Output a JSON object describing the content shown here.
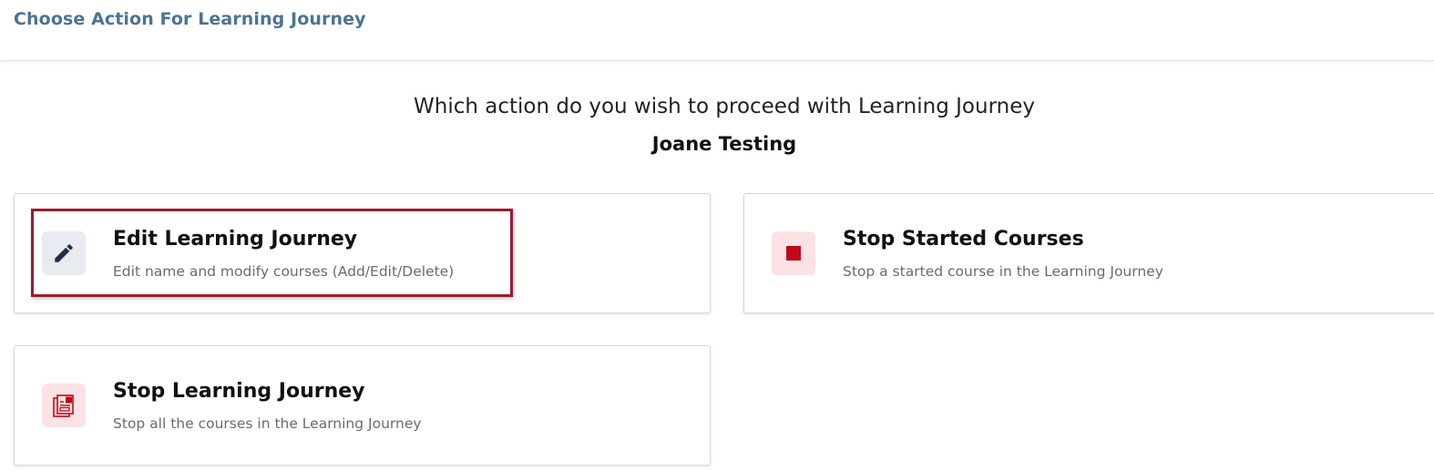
{
  "header": {
    "title": "Choose Action For Learning Journey"
  },
  "prompt": {
    "question": "Which action do you wish to proceed with Learning Journey",
    "journey_name": "Joane Testing"
  },
  "actions": [
    {
      "title": "Edit Learning Journey",
      "description": "Edit name and modify courses (Add/Edit/Delete)",
      "icon": "pencil-icon",
      "highlighted": true
    },
    {
      "title": "Stop Started Courses",
      "description": "Stop a started course in the Learning Journey",
      "icon": "stop-square-icon"
    },
    {
      "title": "Stop Learning Journey",
      "description": "Stop all the courses in the Learning Journey",
      "icon": "stop-journey-icon"
    }
  ],
  "colors": {
    "header_title": "#4a7494",
    "highlight_border": "#9b1b30",
    "stop_red": "#c0091a",
    "icon_pink_bg": "#fbe3e5",
    "icon_gray_bg": "#e8ebef",
    "pencil": "#1f3045"
  }
}
